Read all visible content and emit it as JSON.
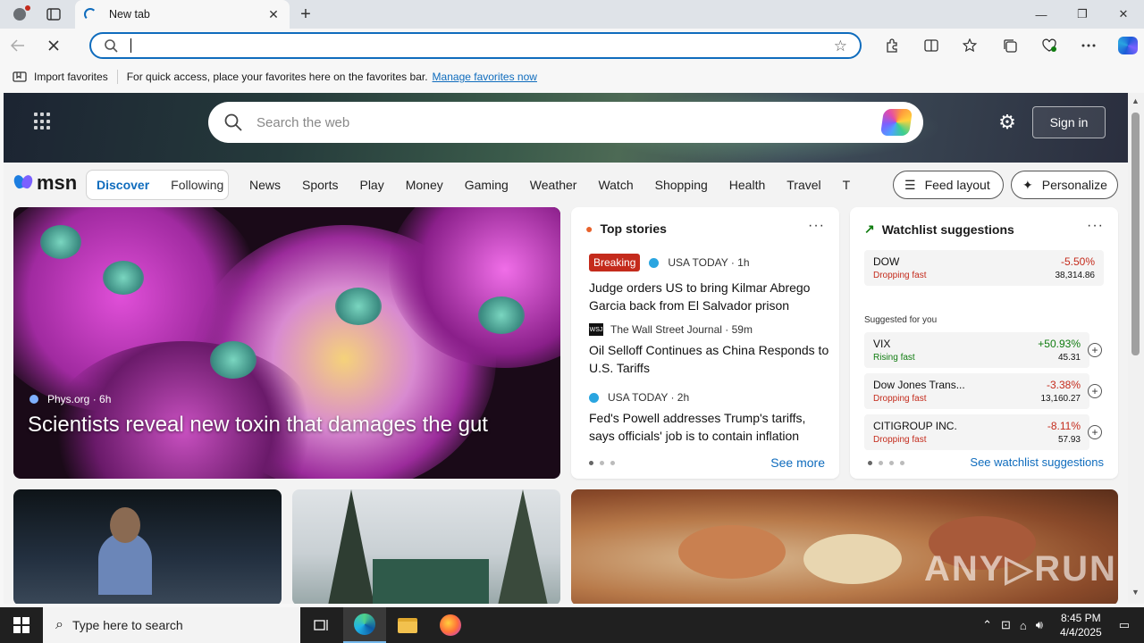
{
  "browser": {
    "tab_title": "New tab",
    "new_tab_label": "+",
    "close_tab": "✕",
    "address_value": "",
    "window_controls": [
      "—",
      "❐",
      "✕"
    ]
  },
  "favorites_bar": {
    "import_label": "Import favorites",
    "hint": "For quick access, place your favorites here on the favorites bar.",
    "manage_link": "Manage favorites now"
  },
  "msn": {
    "search_placeholder": "Search the web",
    "signin": "Sign in",
    "logo": "msn",
    "tabs": [
      "Discover",
      "Following"
    ],
    "categories": [
      "News",
      "Sports",
      "Play",
      "Money",
      "Gaming",
      "Weather",
      "Watch",
      "Shopping",
      "Health",
      "Travel",
      "Tra"
    ],
    "feed_layout": "Feed layout",
    "personalize": "Personalize"
  },
  "hero": {
    "source": "Phys.org",
    "age": "6h",
    "headline": "Scientists reveal new toxin that damages the gut"
  },
  "top_stories": {
    "title": "Top stories",
    "more": "···",
    "see_more": "See more",
    "items": [
      {
        "badge": "Breaking",
        "source": "USA TODAY · 1h",
        "headline": "Judge orders US to bring Kilmar Abrego Garcia back from El Salvador prison"
      },
      {
        "source": "The Wall Street Journal · 59m",
        "headline": "Oil Selloff Continues as China Responds to U.S. Tariffs"
      },
      {
        "source": "USA TODAY · 2h",
        "headline": "Fed's Powell addresses Trump's tariffs, says officials' job is to contain inflation"
      }
    ]
  },
  "watchlist": {
    "title": "Watchlist suggestions",
    "more": "···",
    "suggested_label": "Suggested for you",
    "see_link": "See watchlist suggestions",
    "main": {
      "name": "DOW",
      "status": "Dropping fast",
      "change": "-5.50%",
      "value": "38,314.86"
    },
    "items": [
      {
        "name": "VIX",
        "status": "Rising fast",
        "change": "+50.93%",
        "value": "45.31"
      },
      {
        "name": "Dow Jones Trans...",
        "status": "Dropping fast",
        "change": "-3.38%",
        "value": "13,160.27"
      },
      {
        "name": "CITIGROUP INC.",
        "status": "Dropping fast",
        "change": "-8.11%",
        "value": "57.93"
      }
    ]
  },
  "watermark": "ANY▷RUN",
  "taskbar": {
    "search_placeholder": "Type here to search",
    "time": "8:45 PM",
    "date": "4/4/2025"
  },
  "colors": {
    "accent": "#0f6cbd",
    "negative": "#c42b1c",
    "positive": "#107c10"
  }
}
